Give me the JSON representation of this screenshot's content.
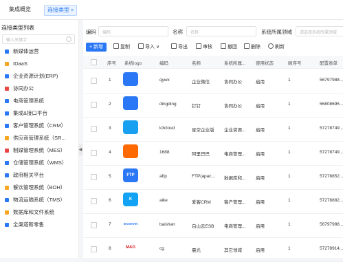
{
  "tabs": {
    "overview": "集成概览",
    "current": "连接类型",
    "close": "×"
  },
  "sidebar": {
    "title": "连接类型列表",
    "search_placeholder": "输入关键字",
    "items": [
      {
        "label": "新媒体运营",
        "color": "#2b78f6"
      },
      {
        "label": "IDaaS",
        "color": "#f6a623"
      },
      {
        "label": "企业资源计划(ERP)",
        "color": "#2b78f6"
      },
      {
        "label": "协同办公",
        "color": "#e84545"
      },
      {
        "label": "电商管理系统",
        "color": "#2b78f6"
      },
      {
        "label": "集成&接口平台",
        "color": "#2b78f6"
      },
      {
        "label": "客户管理系统（CRM）",
        "color": "#2b78f6"
      },
      {
        "label": "供应商管理系统（SR...",
        "color": "#f6a623"
      },
      {
        "label": "制媒管理系统（MES）",
        "color": "#e84545"
      },
      {
        "label": "仓储管理系统（WMS）",
        "color": "#2b78f6"
      },
      {
        "label": "政府相关平台",
        "color": "#2b78f6"
      },
      {
        "label": "餐饮管理系统（BOH）",
        "color": "#f6a623"
      },
      {
        "label": "物流运输系统（TMS）",
        "color": "#2b78f6"
      },
      {
        "label": "数据库和文件系统",
        "color": "#f6a623"
      },
      {
        "label": "全渠道新零售",
        "color": "#2b78f6"
      }
    ]
  },
  "filters": {
    "code_label": "编码",
    "code_placeholder": "编码",
    "name_label": "名称",
    "name_placeholder": "名称",
    "domain_label": "系统所属领域",
    "domain_placeholder": "请选择系统所属领域"
  },
  "toolbar": {
    "add": "+ 新增",
    "copy": "复制",
    "import": "导入",
    "import_caret": "∨",
    "export": "导出",
    "approve": "审核",
    "revoke": "撤回",
    "delete": "删除",
    "refresh": "刷新"
  },
  "table": {
    "headers": [
      "序号",
      "系统logo",
      "编码",
      "名称",
      "系统所属...",
      "使用状态",
      "顺序号",
      "配置表单"
    ],
    "rows": [
      {
        "no": "1",
        "code": "qywx",
        "name": "企业微信",
        "domain": "协同办公",
        "status": "启用",
        "order": "1",
        "form": "56797988..."
      },
      {
        "no": "2",
        "code": "dingding",
        "name": "钉钉",
        "domain": "协同办公",
        "status": "启用",
        "order": "1",
        "form": "56808695..."
      },
      {
        "no": "3",
        "code": "k3cloud",
        "name": "星空企业版",
        "domain": "企业资源...",
        "status": "启用",
        "order": "1",
        "form": "57278749..."
      },
      {
        "no": "4",
        "code": "1688",
        "name": "阿里巴巴",
        "domain": "电商管理...",
        "status": "启用",
        "order": "1",
        "form": "57278749..."
      },
      {
        "no": "5",
        "code": "aftp",
        "name": "FTP(apac...",
        "domain": "数据库和...",
        "status": "启用",
        "order": "1",
        "form": "57278852..."
      },
      {
        "no": "6",
        "code": "aike",
        "name": "爱客CRM",
        "domain": "客户管理...",
        "status": "启用",
        "order": "1",
        "form": "57278882..."
      },
      {
        "no": "7",
        "code": "baishan",
        "name": "白山云ESB",
        "domain": "电商管理...",
        "status": "启用",
        "order": "1",
        "form": "56797988..."
      },
      {
        "no": "8",
        "code": "cg",
        "name": "晨光",
        "domain": "其它领域",
        "status": "启用",
        "order": "1",
        "form": "57278914..."
      }
    ]
  },
  "logos": {
    "1": {
      "label": "",
      "color": "#2b78f6"
    },
    "2": {
      "label": "",
      "color": "#2b78f6"
    },
    "3": {
      "label": "",
      "color": "#19a0f0"
    },
    "4": {
      "label": "",
      "color": "#ff6a00"
    },
    "5": {
      "label": "FTP",
      "color": "#2b78f6"
    },
    "6": {
      "label": "K",
      "color": "#12a3f4"
    },
    "7": {
      "label": "BAISHAN",
      "color": "#2b78f6"
    },
    "8": {
      "label": "M&G",
      "color": "#d8262b"
    }
  }
}
